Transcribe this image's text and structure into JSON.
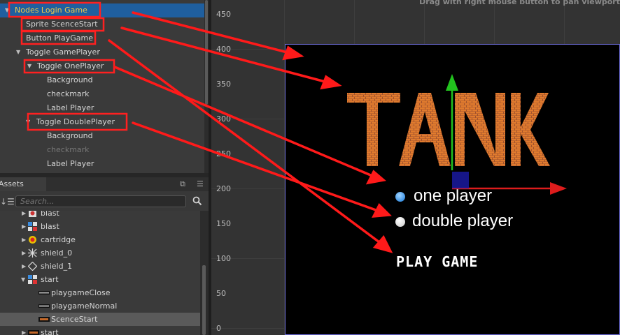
{
  "hierarchy": {
    "items": [
      {
        "label": "Nodes Login Game"
      },
      {
        "label": "Sprite ScenceStart"
      },
      {
        "label": "Button PlayGame"
      },
      {
        "label": "Toggle GamePlayer"
      },
      {
        "label": "Toggle OnePlayer"
      },
      {
        "label": "Background"
      },
      {
        "label": "checkmark"
      },
      {
        "label": "Label Player"
      },
      {
        "label": "Toggle DoublePlayer"
      },
      {
        "label": "Background"
      },
      {
        "label": "checkmark"
      },
      {
        "label": "Label Player"
      }
    ]
  },
  "assets": {
    "tab_label": "Assets",
    "search_placeholder": "Search...",
    "items": [
      {
        "label": "blast",
        "icon": "sprite-icon"
      },
      {
        "label": "blast",
        "icon": "atlas-icon"
      },
      {
        "label": "cartridge",
        "icon": "sprite-icon"
      },
      {
        "label": "shield_0",
        "icon": "sprite-icon"
      },
      {
        "label": "shield_1",
        "icon": "sprite-icon"
      },
      {
        "label": "start",
        "icon": "atlas-icon"
      },
      {
        "label": "playgameClose",
        "icon": "frame-icon"
      },
      {
        "label": "playgameNormal",
        "icon": "frame-icon"
      },
      {
        "label": "ScenceStart",
        "icon": "frame-icon"
      },
      {
        "label": "start",
        "icon": "frame-icon"
      }
    ]
  },
  "scene": {
    "hint": "Drag with right mouse button to pan viewport",
    "y_labels": [
      "450",
      "400",
      "350",
      "300",
      "250",
      "200",
      "150",
      "100",
      "50",
      "0"
    ],
    "title": "TANK",
    "option_one": "one player",
    "option_two": "double player",
    "play_button": "PLAY GAME"
  },
  "colors": {
    "selection": "#1f5f9f",
    "highlight_box": "#ff2020",
    "arrow": "#ff1a1a",
    "brick": "#d2691e",
    "gizmo_x": "#dd1c1c",
    "gizmo_y": "#22c21e"
  }
}
